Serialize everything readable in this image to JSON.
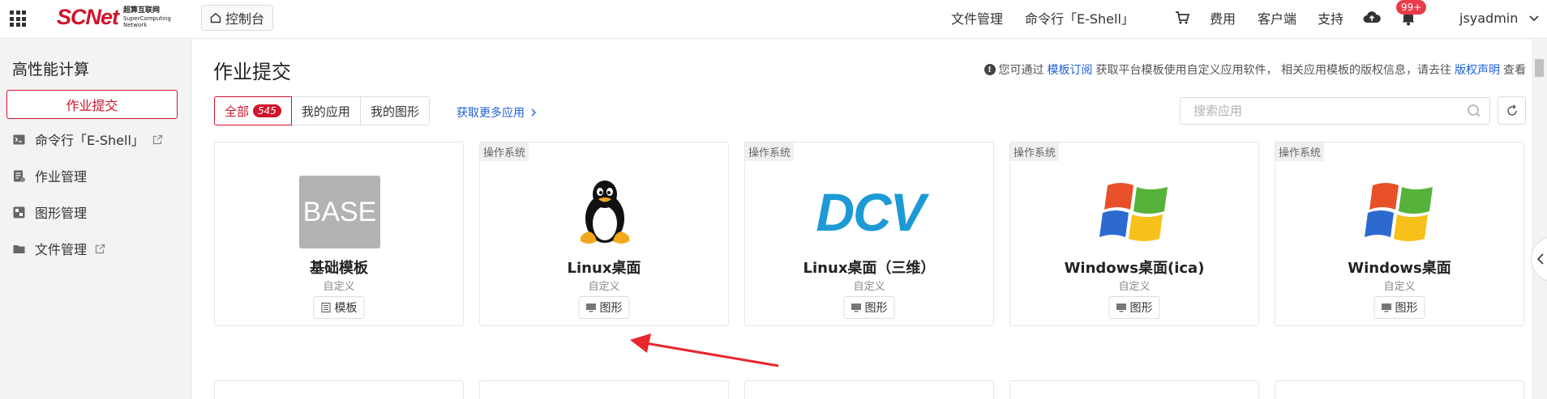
{
  "header": {
    "logo_text": "SCNet",
    "logo_sub_cn": "超算互联网",
    "logo_sub_en": "SuperComputing Network",
    "console_label": "控制台",
    "nav": {
      "files": "文件管理",
      "eshell": "命令行「E-Shell」",
      "fees": "费用",
      "client": "客户端",
      "support": "支持",
      "notifications_badge": "99+",
      "user": "jsyadmin"
    }
  },
  "sidebar": {
    "title": "高性能计算",
    "active_item": "作业提交",
    "items": [
      {
        "label": "命令行「E-Shell」",
        "icon": "terminal-icon",
        "external": true
      },
      {
        "label": "作业管理",
        "icon": "job-icon",
        "external": false
      },
      {
        "label": "图形管理",
        "icon": "graphics-icon",
        "external": false
      },
      {
        "label": "文件管理",
        "icon": "folder-icon",
        "external": true
      }
    ]
  },
  "main": {
    "title": "作业提交",
    "notice": {
      "prefix": "您可通过",
      "link1": "模板订阅",
      "middle": "获取平台模板使用自定义应用软件， 相关应用模板的版权信息，请去往",
      "link2": "版权声明",
      "suffix": "查看"
    },
    "tabs": [
      {
        "label": "全部",
        "badge": "545",
        "active": true
      },
      {
        "label": "我的应用",
        "active": false
      },
      {
        "label": "我的图形",
        "active": false
      }
    ],
    "more_link": "获取更多应用",
    "search_placeholder": "搜索应用",
    "cards": [
      {
        "tag": "",
        "name": "基础模板",
        "sub": "自定义",
        "type_label": "模板",
        "type_icon": "template-icon",
        "logo": "BASE"
      },
      {
        "tag": "操作系统",
        "name": "Linux桌面",
        "sub": "自定义",
        "type_label": "图形",
        "type_icon": "monitor-icon",
        "logo": "linux-penguin"
      },
      {
        "tag": "操作系统",
        "name": "Linux桌面（三维）",
        "sub": "自定义",
        "type_label": "图形",
        "type_icon": "monitor-icon",
        "logo": "DCV"
      },
      {
        "tag": "操作系统",
        "name": "Windows桌面(ica)",
        "sub": "自定义",
        "type_label": "图形",
        "type_icon": "monitor-icon",
        "logo": "windows-flag"
      },
      {
        "tag": "操作系统",
        "name": "Windows桌面",
        "sub": "自定义",
        "type_label": "图形",
        "type_icon": "monitor-icon",
        "logo": "windows-flag"
      }
    ]
  },
  "colors": {
    "brand_red": "#d0142c",
    "link_blue": "#1f5fd6",
    "annotation_arrow": "#e8262e"
  }
}
